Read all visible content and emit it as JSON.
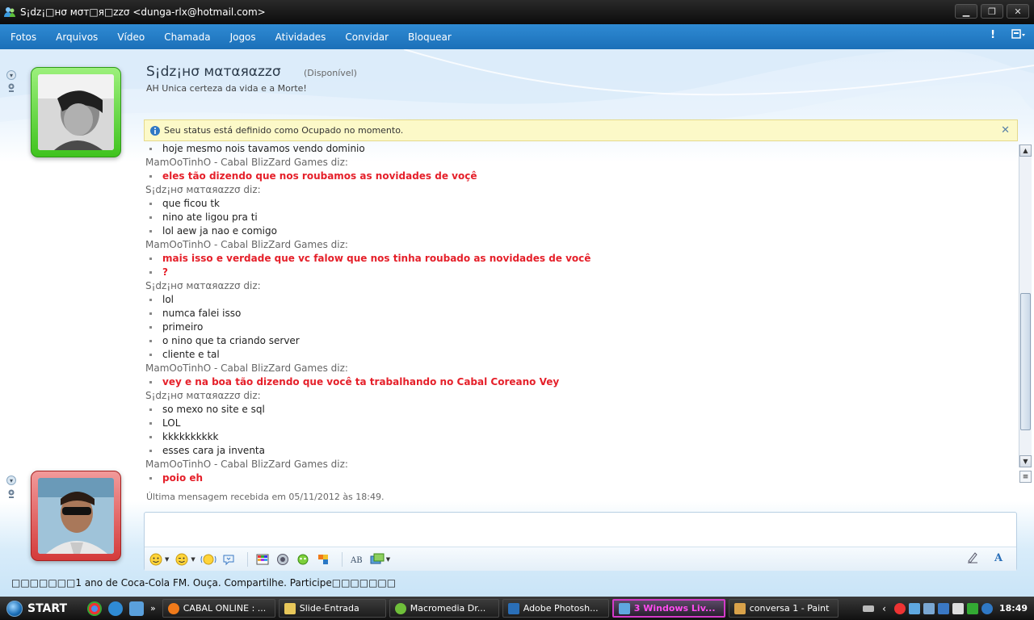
{
  "window": {
    "title": "S¡dz¡□нσ мσт□я□zzσ <dunga-rlx@hotmail.com>",
    "min_label": "▁",
    "max_label": "❐",
    "close_label": "✕"
  },
  "menu": {
    "items": [
      "Fotos",
      "Arquivos",
      "Vídeo",
      "Chamada",
      "Jogos",
      "Atividades",
      "Convidar",
      "Bloquear"
    ],
    "alert_label": "!",
    "options_label": "▾"
  },
  "contact": {
    "name": "S¡dz¡нσ мαтαяαzzσ",
    "status": "(Disponível)",
    "personal_message": "AH Unica certeza da vida e a Morte!"
  },
  "info_bar": {
    "text": "Seu status está definido como Ocupado no momento.",
    "close_label": "✕"
  },
  "conversation": [
    {
      "type": "msg",
      "style": "dark",
      "text": "hoje mesmo nois tavamos vendo dominio"
    },
    {
      "type": "sender",
      "text": "MamOoTinhO - Cabal BlizZard Games diz:"
    },
    {
      "type": "msg",
      "style": "red",
      "text": "eles tão dizendo que nos roubamos as novidades de voçê"
    },
    {
      "type": "sender",
      "text": "S¡dz¡нσ мαтαяαzzσ diz:"
    },
    {
      "type": "msg",
      "style": "dark",
      "text": "que ficou tk"
    },
    {
      "type": "msg",
      "style": "dark",
      "text": "nino ate ligou pra ti"
    },
    {
      "type": "msg",
      "style": "dark",
      "text": "lol aew ja nao e comigo"
    },
    {
      "type": "sender",
      "text": "MamOoTinhO - Cabal BlizZard Games diz:"
    },
    {
      "type": "msg",
      "style": "red",
      "text": "mais isso e verdade que vc falow que nos tinha roubado as novidades de você"
    },
    {
      "type": "msg",
      "style": "red",
      "text": "?"
    },
    {
      "type": "sender",
      "text": "S¡dz¡нσ мαтαяαzzσ diz:"
    },
    {
      "type": "msg",
      "style": "dark",
      "text": "lol"
    },
    {
      "type": "msg",
      "style": "dark",
      "text": "numca falei isso"
    },
    {
      "type": "msg",
      "style": "dark",
      "text": "primeiro"
    },
    {
      "type": "msg",
      "style": "dark",
      "text": "o nino que ta criando server"
    },
    {
      "type": "msg",
      "style": "dark",
      "text": "cliente e tal"
    },
    {
      "type": "sender",
      "text": "MamOoTinhO - Cabal BlizZard Games diz:"
    },
    {
      "type": "msg",
      "style": "red",
      "text": "vey e na boa tão dizendo que você ta trabalhando no Cabal Coreano Vey"
    },
    {
      "type": "sender",
      "text": "S¡dz¡нσ мαтαяαzzσ diz:"
    },
    {
      "type": "msg",
      "style": "dark",
      "text": "so mexo no site e sql"
    },
    {
      "type": "msg",
      "style": "dark",
      "text": "LOL"
    },
    {
      "type": "msg",
      "style": "dark",
      "text": "kkkkkkkkkk"
    },
    {
      "type": "msg",
      "style": "dark",
      "text": "esses cara ja inventa"
    },
    {
      "type": "sender",
      "text": "MamOoTinhO - Cabal BlizZard Games diz:"
    },
    {
      "type": "msg",
      "style": "red",
      "text": "poio eh"
    }
  ],
  "last_message": "Última mensagem recebida em 05/11/2012 às 18:49.",
  "ticker": "□□□□□□□1 ano de Coca-Cola FM. Ouça. Compartilhe. Participe□□□□□□□",
  "taskbar": {
    "start_label": "START",
    "more_label": "»",
    "tasks": [
      {
        "label": "CABAL ONLINE : ...",
        "color": "#f07a1a"
      },
      {
        "label": "Slide-Entrada",
        "color": "#e8c75a"
      },
      {
        "label": "Macromedia Dr...",
        "color": "#6fbf3a"
      },
      {
        "label": "Adobe Photosh...",
        "color": "#2a6fb8"
      },
      {
        "label": "3 Windows Liv...",
        "color": "#5fa8e0"
      },
      {
        "label": "conversa 1 - Paint",
        "color": "#d9a24a"
      }
    ],
    "clock": "18:49"
  }
}
